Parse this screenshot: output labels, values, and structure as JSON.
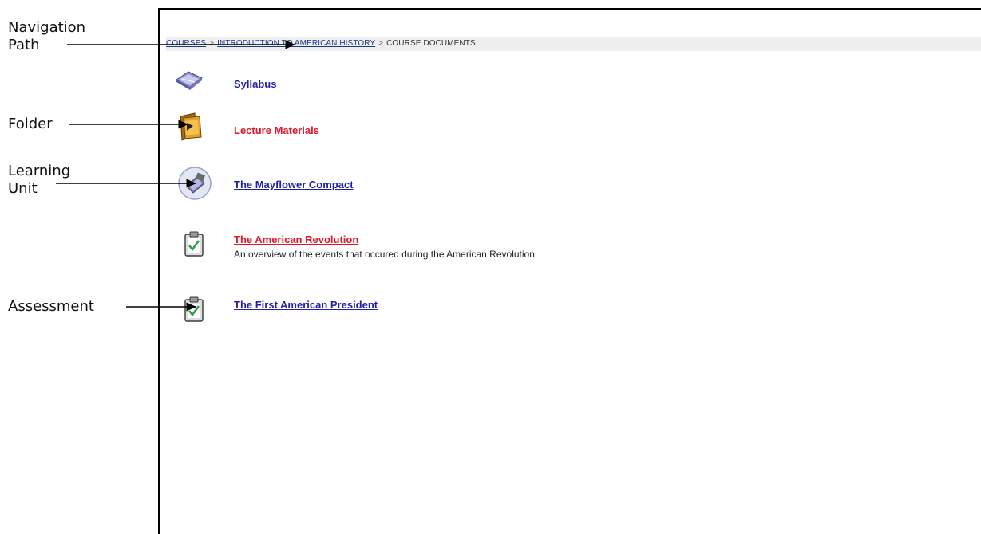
{
  "breadcrumb": {
    "items": [
      "COURSES",
      "INTRODUCTION TO AMERICAN HISTORY",
      "COURSE DOCUMENTS"
    ],
    "separator": ">"
  },
  "content": {
    "items": [
      {
        "title": "Syllabus",
        "icon": "book-icon",
        "color": "#1f1fa8",
        "link": false
      },
      {
        "title": "Lecture Materials",
        "icon": "folder-icon",
        "color": "#e0182a",
        "link": true
      },
      {
        "title": "The Mayflower Compact",
        "icon": "learning-unit-icon",
        "color": "#1f1fa8",
        "link": true
      },
      {
        "title": "The American Revolution",
        "description": "An overview of the events that occured during the American Revolution.",
        "icon": "clipboard-check-icon",
        "color": "#e0182a",
        "link": true
      },
      {
        "title": "The First American President",
        "icon": "clipboard-check-icon",
        "color": "#1f1fa8",
        "link": true
      }
    ]
  },
  "annotations": {
    "navigation_path": "Navigation Path",
    "navigation_path_line1": "Navigation",
    "navigation_path_line2": "Path",
    "folder": "Folder",
    "learning_unit_line1": "Learning",
    "learning_unit_line2": "Unit",
    "assessment": "Assessment"
  }
}
